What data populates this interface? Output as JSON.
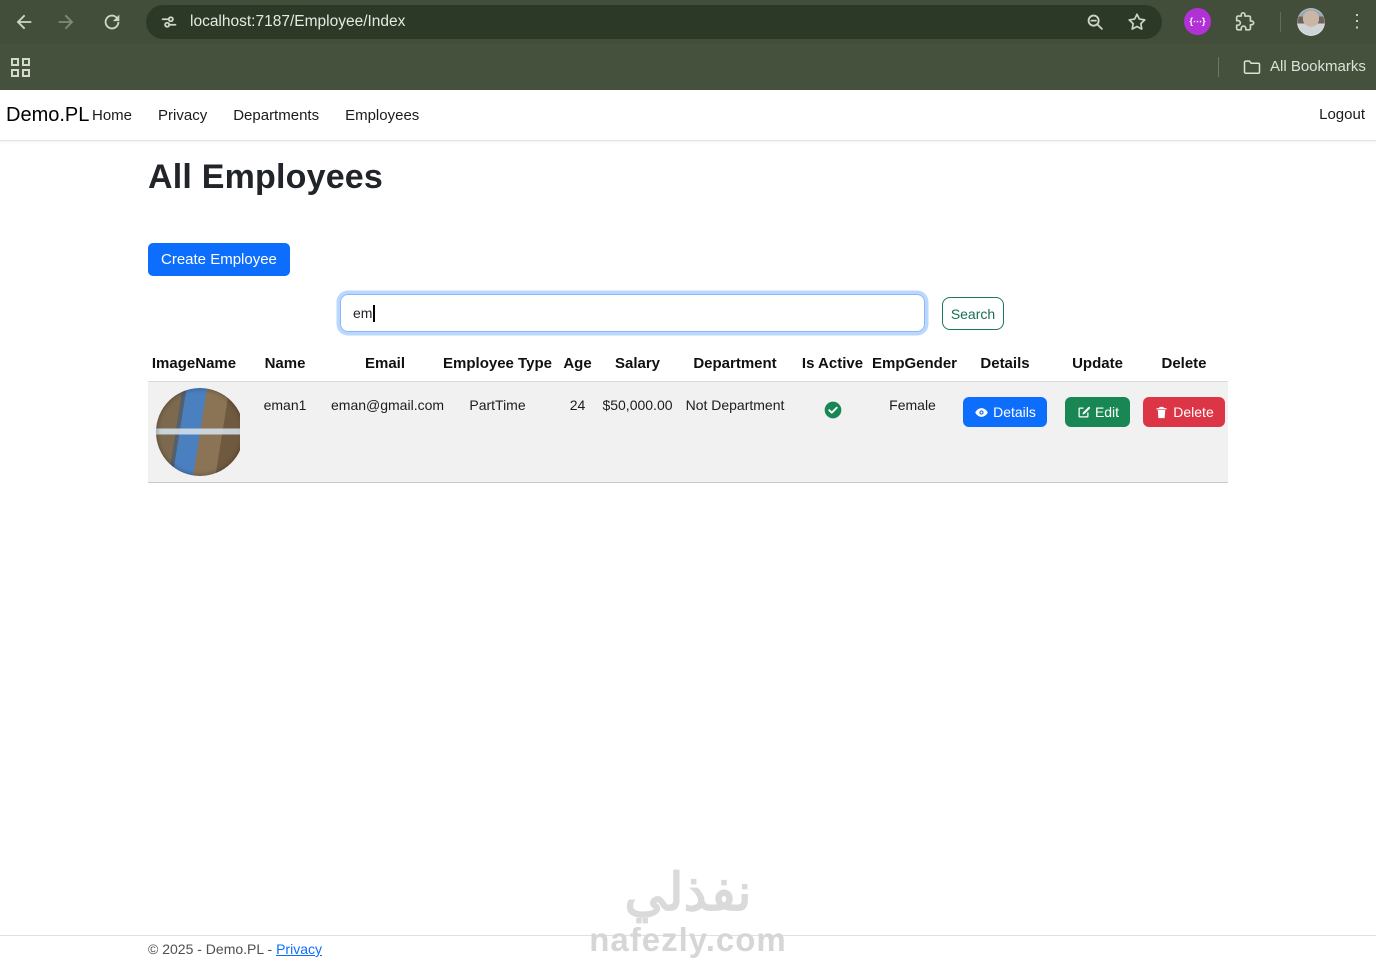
{
  "browser": {
    "url": "localhost:7187/Employee/Index",
    "all_bookmarks_label": "All Bookmarks",
    "icons": {
      "back": "←",
      "forward": "→",
      "refresh": "circular-arrow",
      "tune": "site-settings-sliders",
      "zoom_out": "magnifier-minus",
      "star": "☆",
      "extension_badge": "{⋯}",
      "puzzle": "extensions-puzzle",
      "more": "⋮",
      "apps_grid": "2x2-squares",
      "folder": "bookmarks-folder"
    }
  },
  "navbar": {
    "brand": "Demo.PL",
    "links": [
      "Home",
      "Privacy",
      "Departments",
      "Employees"
    ],
    "logout": "Logout"
  },
  "page": {
    "title": "All Employees",
    "create_button": "Create Employee",
    "search": {
      "value": "em",
      "button": "Search"
    }
  },
  "table": {
    "headers": [
      "ImageName",
      "Name",
      "Email",
      "Employee Type",
      "Age",
      "Salary",
      "Department",
      "Is Active",
      "EmpGender",
      "Details",
      "Update",
      "Delete"
    ],
    "rows": [
      {
        "name": "eman1",
        "email": "eman@gmail.com",
        "employee_type": "PartTime",
        "age": "24",
        "salary": "$50,000.00",
        "department": "Not Department",
        "is_active": true,
        "gender": "Female",
        "details_label": "Details",
        "edit_label": "Edit",
        "delete_label": "Delete"
      }
    ]
  },
  "footer": {
    "copyright": "© 2025 - Demo.PL - ",
    "privacy_link": "Privacy"
  },
  "watermark": {
    "arabic": "نفذلي",
    "latin": "nafezly.com"
  },
  "colors": {
    "toolbar_green": "#424e3a",
    "bookmarks_green": "#45513d",
    "url_pill_green": "#2c3927",
    "accent_blue": "#0d6efd",
    "success_green": "#198754",
    "danger_red": "#dc3545",
    "row_gray": "#f1f1f2",
    "extension_purple": "#b231d6"
  }
}
